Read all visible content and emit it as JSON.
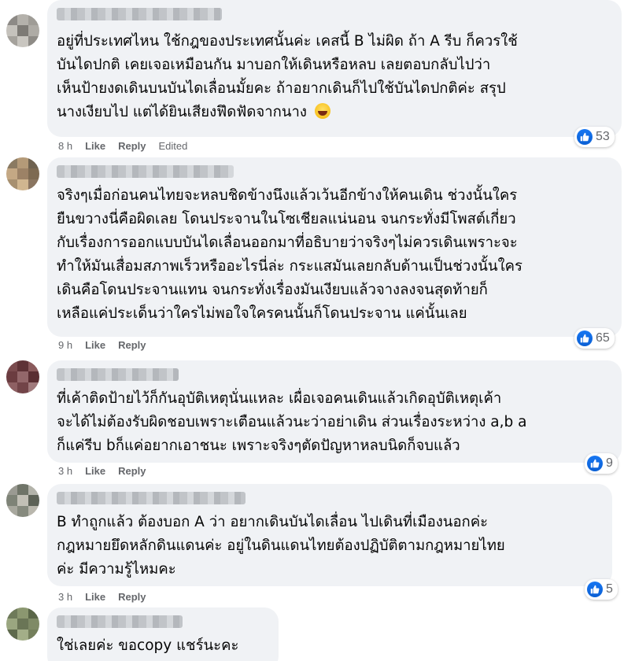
{
  "comments": [
    {
      "text": "อยู่ที่ประเทศไหน ใช้กฎของประเทศนั้นค่ะ เคสนี้ B ไม่ผิด ถ้า A รีบ ก็ควรใช้\nบันไดปกติ เคยเจอเหมือนกัน มาบอกให้เดินหรือหลบ เลยตอบกลับไปว่า\nเห็นป้ายงดเดินบนบันไดเลื่อนมั้ยคะ ถ้าอยากเดินก็ไปใช้บันไดปกติค่ะ สรุป\nนางเงียบไป แต่ได้ยินเสียงฟึดฟัดจากนาง",
      "emoji": "laughing-tears-emoji",
      "time": "8 h",
      "like": "Like",
      "reply": "Reply",
      "edited": "Edited",
      "reaction_count": "53"
    },
    {
      "text": "จริงๆเมื่อก่อนคนไทยจะหลบชิดข้างนึงแล้วเว้นอีกข้างให้คนเดิน ช่วงนั้นใคร\nยืนขวางนี่คือผิดเลย โดนประจานในโซเชียลแน่นอน จนกระทั่งมีโพสต์เกี่ยว\nกับเรื่องการออกแบบบันไดเลื่อนออกมาที่อธิบายว่าจริงๆไม่ควรเดินเพราะจะ\nทำให้มันเสื่อมสภาพเร็วหรืออะไรนี่ล่ะ กระแสมันเลยกลับด้านเป็นช่วงนั้นใคร\nเดินคือโดนประจานแทน จนกระทั่งเรื่องมันเงียบแล้วจางลงจนสุดท้ายก็\nเหลือแค่ประเด็นว่าใครไม่พอใจใครคนนั้นก็โดนประจาน แค่นั้นเลย",
      "time": "9 h",
      "like": "Like",
      "reply": "Reply",
      "reaction_count": "65"
    },
    {
      "text": "ที่เค้าติดป้ายไว้ก็กันอุบัติเหตุนั่นแหละ เผื่อเจอคนเดินแล้วเกิดอุบัติเหตุเค้า\nจะได้ไม่ต้องรับผิดชอบเพราะเตือนแล้วนะว่าอย่าเดิน ส่วนเรื่องระหว่าง a,b a\nก็แค่รีบ bก็แค่อยากเอาชนะ เพราะจริงๆตัดปัญหาหลบนิดก็จบแล้ว",
      "time": "3 h",
      "like": "Like",
      "reply": "Reply",
      "reaction_count": "9"
    },
    {
      "text": "B ทำถูกแล้ว ต้องบอก A ว่า อยากเดินบันไดเลื่อน ไปเดินที่เมืองนอกค่ะ\nกฎหมายยึดหลักดินแดนค่ะ อยู่ในดินแดนไทยต้องปฏิบัติตามกฎหมายไทย\nค่ะ มีความรู้ไหมคะ",
      "time": "3 h",
      "like": "Like",
      "reply": "Reply",
      "reaction_count": "5"
    },
    {
      "text": "ใช่เลยค่ะ ขอcopy แชร์นะคะ"
    }
  ],
  "colors": {
    "bubble": "#f0f2f5",
    "text": "#050505",
    "meta": "#65676b",
    "like_blue": "#1877f2"
  }
}
